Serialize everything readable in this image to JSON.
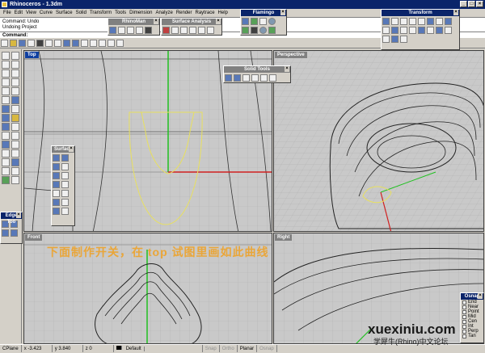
{
  "window": {
    "title": "Rhinoceros - 1.3dm",
    "buttons": [
      "_",
      "□",
      "×"
    ]
  },
  "menu": [
    "File",
    "Edit",
    "View",
    "Curve",
    "Surface",
    "Solid",
    "Transform",
    "Tools",
    "Dimension",
    "Analyze",
    "Render",
    "Raytrace",
    "Help"
  ],
  "command": {
    "history": [
      "Command: Undo",
      "Undoing Project"
    ],
    "prompt": "Command:"
  },
  "panels": {
    "flamingo": "Flamingo",
    "rhinoman": "RhinoMan",
    "surface_analysis": "Surface Analysis",
    "solid_tools": "Solid Tools",
    "surface": "Surface",
    "transform": "Transform",
    "edge_tools": "Edge Too",
    "osnap": {
      "title": "Osnap",
      "items": [
        "End",
        "Near",
        "Point",
        "Mid",
        "Cen",
        "Int",
        "Perp",
        "Tan",
        "Quad",
        "Knot",
        "Proj",
        "Stop"
      ]
    }
  },
  "viewports": {
    "top": "Top",
    "perspective": "Perspective",
    "front": "Front",
    "right": "Right"
  },
  "overlay_text": "下面制作开关，在 top 试图里画如此曲线",
  "status": {
    "cplane": "CPlane",
    "x": "x -3.423",
    "y": "y 3.840",
    "z": "z 0",
    "layer": "Default",
    "snap": "Snap",
    "ortho": "Ortho",
    "planar": "Planar",
    "osnap": "Osnap"
  },
  "watermark": {
    "url": "xuexiniu.com",
    "cn": "学犀牛(Rhino)中文论坛"
  },
  "colors": {
    "title_active": "#0a246a",
    "viewport_bg": "#c9c9c9",
    "curve": "#e8e060",
    "x_axis": "#d02020",
    "y_axis": "#20c020"
  }
}
